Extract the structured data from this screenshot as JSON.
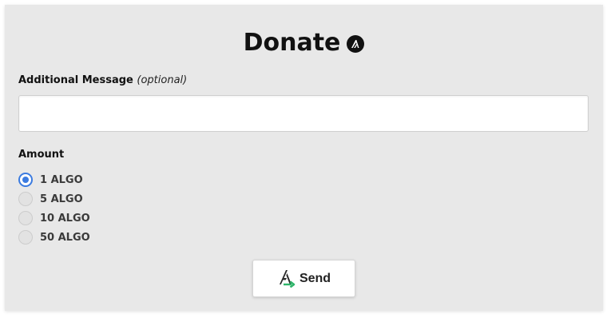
{
  "header": {
    "title": "Donate",
    "icon": "algorand-icon"
  },
  "message": {
    "label": "Additional Message",
    "label_hint": "(optional)",
    "value": "",
    "placeholder": ""
  },
  "amount": {
    "label": "Amount",
    "selected": "1 ALGO",
    "options": [
      "1 ALGO",
      "5 ALGO",
      "10 ALGO",
      "50 ALGO"
    ]
  },
  "send": {
    "label": "Send",
    "icon": "algorand-send-icon"
  },
  "colors": {
    "background": "#e8e8e8",
    "accent": "#3b7be0",
    "send_arrow": "#2fb56a"
  }
}
